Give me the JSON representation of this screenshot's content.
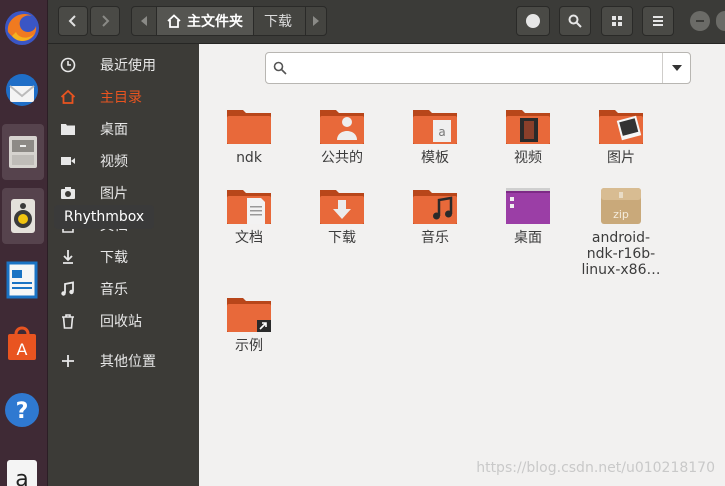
{
  "dock": {
    "tooltip": "Rhythmbox"
  },
  "headerbar": {
    "path": [
      "主文件夹",
      "下载"
    ]
  },
  "sidebar": {
    "items": [
      {
        "label": "最近使用",
        "icon": "clock-icon"
      },
      {
        "label": "主目录",
        "icon": "home-icon",
        "active": true
      },
      {
        "label": "桌面",
        "icon": "folder-icon"
      },
      {
        "label": "视频",
        "icon": "video-icon"
      },
      {
        "label": "图片",
        "icon": "camera-icon"
      },
      {
        "label": "文档",
        "icon": "document-icon"
      },
      {
        "label": "下载",
        "icon": "download-icon"
      },
      {
        "label": "音乐",
        "icon": "music-icon"
      },
      {
        "label": "回收站",
        "icon": "trash-icon"
      },
      {
        "label": "其他位置",
        "icon": "plus-icon"
      }
    ]
  },
  "files": [
    {
      "label": "ndk",
      "icon": "folder-icon"
    },
    {
      "label": "公共的",
      "icon": "folder-public-icon"
    },
    {
      "label": "模板",
      "icon": "folder-templates-icon"
    },
    {
      "label": "视频",
      "icon": "folder-videos-icon"
    },
    {
      "label": "图片",
      "icon": "folder-pictures-icon"
    },
    {
      "label": "文档",
      "icon": "folder-documents-icon"
    },
    {
      "label": "下载",
      "icon": "folder-downloads-icon"
    },
    {
      "label": "音乐",
      "icon": "folder-music-icon"
    },
    {
      "label": "桌面",
      "icon": "folder-desktop-icon"
    },
    {
      "label": "android-\nndk-r16b-\nlinux-x86…",
      "icon": "zip-archive-icon",
      "zip_text": "zip"
    },
    {
      "label": "示例",
      "icon": "folder-link-icon"
    }
  ],
  "watermark": "https://blog.csdn.net/u010218170",
  "colors": {
    "accent": "#e95420",
    "folder": "#e8693a",
    "desktop_folder": "#9b3ea6"
  }
}
